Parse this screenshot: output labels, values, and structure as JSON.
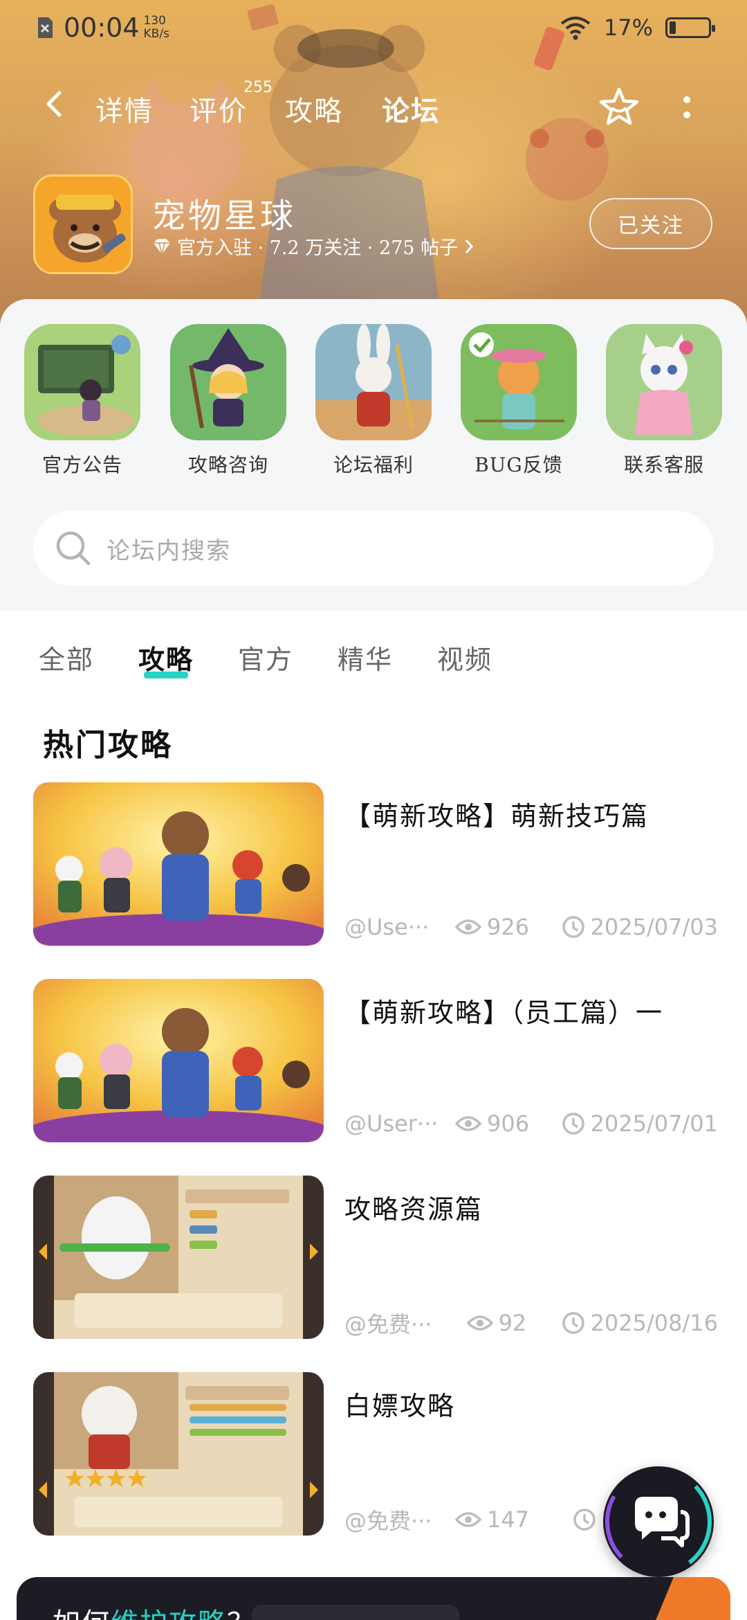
{
  "status_bar": {
    "time": "00:04",
    "speed_value": "130",
    "speed_unit": "KB/s",
    "battery": "17%",
    "battery_level": 0.17
  },
  "nav": {
    "tabs": [
      {
        "label": "详情",
        "active": false
      },
      {
        "label": "评价",
        "active": false,
        "badge": "255"
      },
      {
        "label": "攻略",
        "active": false
      },
      {
        "label": "论坛",
        "active": true
      }
    ],
    "back_icon": "chevron-left-icon",
    "star_icon": "star-outline-icon",
    "more_icon": "more-vertical-icon"
  },
  "game": {
    "name": "宠物星球",
    "meta": "官方入驻 · 7.2 万关注 · 275 帖子",
    "follow_label": "已关注"
  },
  "shortcuts": [
    {
      "label": "官方公告"
    },
    {
      "label": "攻略咨询"
    },
    {
      "label": "论坛福利"
    },
    {
      "label": "BUG反馈"
    },
    {
      "label": "联系客服"
    }
  ],
  "search": {
    "placeholder": "论坛内搜索"
  },
  "filter_tabs": [
    {
      "label": "全部",
      "active": false
    },
    {
      "label": "攻略",
      "active": true
    },
    {
      "label": "官方",
      "active": false
    },
    {
      "label": "精华",
      "active": false
    },
    {
      "label": "视频",
      "active": false
    }
  ],
  "section_title": "热门攻略",
  "posts": [
    {
      "title": "【萌新攻略】萌新技巧篇",
      "author": "@Use···",
      "views": "926",
      "date": "2025/07/03"
    },
    {
      "title": "【萌新攻略】（员工篇）一",
      "author": "@User···",
      "views": "906",
      "date": "2025/07/01"
    },
    {
      "title": "攻略资源篇",
      "author": "@免费···",
      "views": "92",
      "date": "2025/08/16"
    },
    {
      "title": "白嫖攻略",
      "author": "@免费···",
      "views": "147",
      "date": "2"
    }
  ],
  "bottom_card": {
    "text_prefix": "如何",
    "text_highlight": "维护攻略",
    "text_suffix": "？"
  },
  "colors": {
    "accent": "#27d2c6",
    "header_bg": "#d9a45c"
  }
}
